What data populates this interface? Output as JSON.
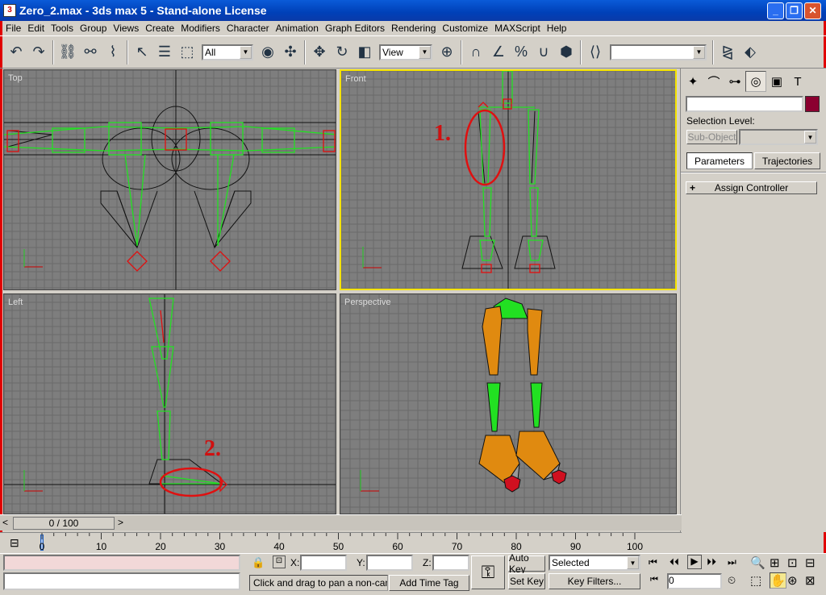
{
  "window": {
    "title": "Zero_2.max - 3ds max 5 - Stand-alone License",
    "min": "_",
    "max": "❐",
    "close": "✕"
  },
  "menu": [
    "File",
    "Edit",
    "Tools",
    "Group",
    "Views",
    "Create",
    "Modifiers",
    "Character",
    "Animation",
    "Graph Editors",
    "Rendering",
    "Customize",
    "MAXScript",
    "Help"
  ],
  "toolbar": {
    "selection_filter": "All",
    "coord_system": "View",
    "named_selection": ""
  },
  "viewports": {
    "top": "Top",
    "front": "Front",
    "left": "Left",
    "perspective": "Perspective"
  },
  "annotations": {
    "one": "1.",
    "two": "2."
  },
  "command_panel": {
    "name_field": "",
    "color_swatch": "#8b0030",
    "selection_level_label": "Selection Level:",
    "sub_object": "Sub-Object",
    "tab_parameters": "Parameters",
    "tab_trajectories": "Trajectories",
    "rollout_toggle": "+",
    "rollout_title": "Assign Controller"
  },
  "timeline": {
    "slider": "0 / 100",
    "ticks": [
      "0",
      "10",
      "20",
      "30",
      "40",
      "50",
      "60",
      "70",
      "80",
      "90",
      "100"
    ]
  },
  "status": {
    "x_label": "X:",
    "y_label": "Y:",
    "z_label": "Z:",
    "x_value": "",
    "y_value": "",
    "z_value": "",
    "auto_key": "Auto Key",
    "set_key": "Set Key",
    "key_mode": "Selected",
    "key_filters": "Key Filters...",
    "frame": "0",
    "prompt": "Click and drag to pan a non-camer",
    "add_time_tag": "Add Time Tag"
  },
  "colors": {
    "viewport_bg": "#7e7e7e",
    "bone_green": "#22e022",
    "selection_red": "#e01010",
    "active_border": "#f5e300",
    "mesh_orange": "#e08a10"
  }
}
